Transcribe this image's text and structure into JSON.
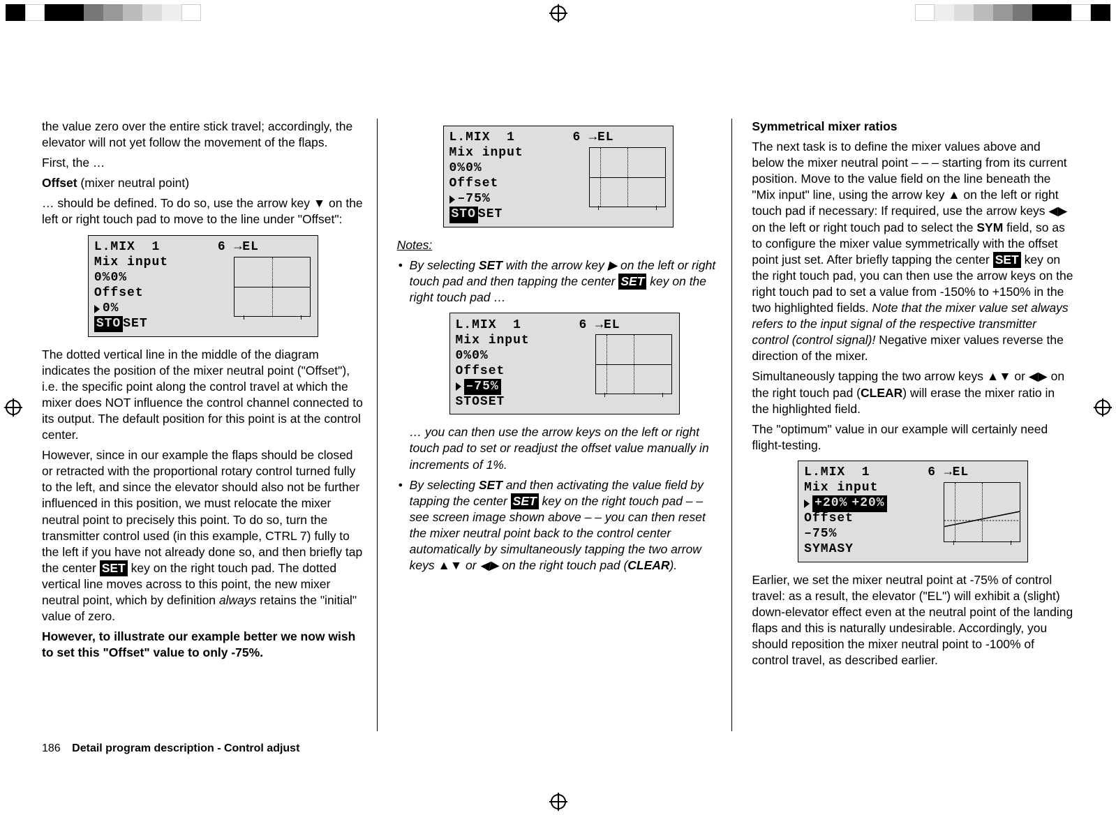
{
  "page_number": "186",
  "footer_title": "Detail program description - Control adjust",
  "col1": {
    "p1": "the value zero over the entire stick travel; accordingly, the elevator will not yet follow the movement of the flaps.",
    "p2": "First, the …",
    "h_offset": "Offset",
    "h_offset_tail": " (mixer neutral point)",
    "p3a": "… should be defined. To do so, use the arrow key ",
    "p3b": " on the left or right touch pad to move to the line under \"Offset\":",
    "p4": "The dotted vertical line in the middle of the diagram indicates the position of the mixer neutral point (\"Offset\"), i.e. the specific point along the control travel at which the mixer does NOT influence the control channel connected to its output. The default position for this point is at the control center.",
    "p5a": "However, since in our example the flaps should be closed or retracted with the proportional rotary control turned fully to the left, and since the elevator should also not be further influenced in this position, we must relocate the mixer neutral point to precisely this point. To do so, turn the transmitter control used (in this example, CTRL 7) fully to the left if you have not already done so, and then briefly tap the center ",
    "p5b": " key on the right touch pad. The dotted vertical line moves across to this point, the new mixer neutral point, which by definition ",
    "p5c": "always",
    "p5d": " retains the \"initial\" value of zero.",
    "p6": "However, to illustrate our example better we now wish to set this \"Offset\" value to only -75%."
  },
  "col2": {
    "notes_h": "Notes:",
    "n1a": "By selecting ",
    "n1b": "SET",
    "n1c": " with the arrow key ",
    "n1d": " on the left or right touch pad and then tapping the center ",
    "n1e": " key on the right touch pad …",
    "n1f": "… you can then use the arrow keys on the left or right touch pad to set or readjust the offset value manually in increments of 1%.",
    "n2a": "By selecting ",
    "n2b": "SET",
    "n2c": " and then activating the value field by tapping the center ",
    "n2d": " key on the right touch pad – – see screen image shown above – – you can then reset the mixer neutral point back to the control center automatically by simultaneously tapping the two arrow keys ",
    "n2e": " or ",
    "n2f": " on the right touch pad (",
    "n2g": "CLEAR",
    "n2h": ")."
  },
  "col3": {
    "h_sym": "Symmetrical mixer ratios",
    "p1a": "The next task is to define the mixer values above and below the mixer neutral point  – –  – starting from its current position. Move to the value field on the line beneath the \"Mix input\" line, using the arrow key ",
    "p1b": " on the left or right touch pad if necessary: If required, use the arrow keys ",
    "p1c": " on the left or right touch pad to select the ",
    "p1d": "SYM",
    "p1e": " field, so as to configure the mixer value symmetrically with the offset point just set. After briefly tapping the center ",
    "p1f": " key on the right touch pad, you can then use the arrow keys on the right touch pad to set a value from -150% to +150% in the two highlighted fields. ",
    "p1g": "Note that the mixer value set always refers to the input signal of the respective transmitter control (control signal)!",
    "p1h": " Negative mixer values reverse the direction of the mixer.",
    "p2a": "Simultaneously tapping the two arrow keys ",
    "p2b": " or ",
    "p2c": " on the right touch pad (",
    "p2d": "CLEAR",
    "p2e": ") will erase the mixer ratio in the highlighted field.",
    "p3": "The \"optimum\" value in our example will certainly need flight-testing.",
    "p4": "Earlier, we set the mixer neutral point at -75% of control travel: as a result, the elevator (\"EL\") will exhibit a (slight) down-elevator effect even at the neutral point of the landing flaps and this is naturally undesirable. Accordingly, you should reposition the mixer neutral point to -100% of control travel, as described earlier."
  },
  "lcd_common": {
    "title": "L.MIX  1       6 ",
    "title_tail": "EL",
    "mix_input": "Mix input",
    "offset": "Offset",
    "sto": "STO",
    "set": "SET",
    "sym": "SYM",
    "asy": "ASY"
  },
  "lcd1": {
    "val_l": "0%",
    "val_r": "0%",
    "offset_val": "0%"
  },
  "lcd2": {
    "val_l": "0%",
    "val_r": "0%",
    "offset_val": "–75%"
  },
  "lcd3": {
    "val_l": "0%",
    "val_r": "0%",
    "offset_val": "–75%"
  },
  "lcd4": {
    "val_l": "+20%",
    "val_r": "+20%",
    "offset_val": "–75%"
  },
  "badges": {
    "set": "SET"
  },
  "glyphs": {
    "down": "▼",
    "up": "▲",
    "left": "◀",
    "right": "▶",
    "to": "→"
  }
}
